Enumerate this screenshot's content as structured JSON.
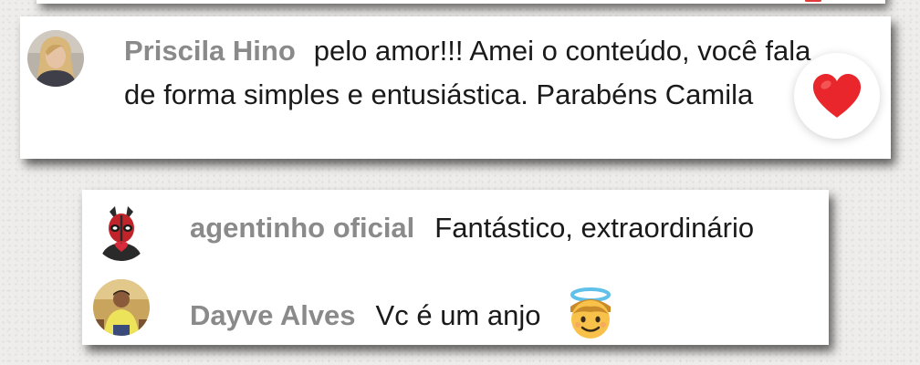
{
  "main_comment": {
    "author": "Priscila Hino",
    "text": "pelo amor!!! Amei o conteúdo, você fala de forma simples e entusiástica. Parabéns Camila",
    "avatar_icon": "profile-photo-woman-blonde",
    "reaction_icon": "red-heart-icon",
    "reaction_color": "#e8262c"
  },
  "replies": [
    {
      "author": "agentinho oficial",
      "text": "Fantástico, extraordinário",
      "avatar_icon": "deadpool-avatar-icon"
    },
    {
      "author": "Dayve Alves",
      "text": "Vc é um anjo",
      "emoji_icon": "angel-face-emoji",
      "avatar_icon": "profile-photo-man-yellow-shirt"
    }
  ],
  "colors": {
    "author_name": "#8a8a8a",
    "comment_text": "#1a1a1a",
    "card_background": "#ffffff",
    "page_background": "#efedeb"
  }
}
